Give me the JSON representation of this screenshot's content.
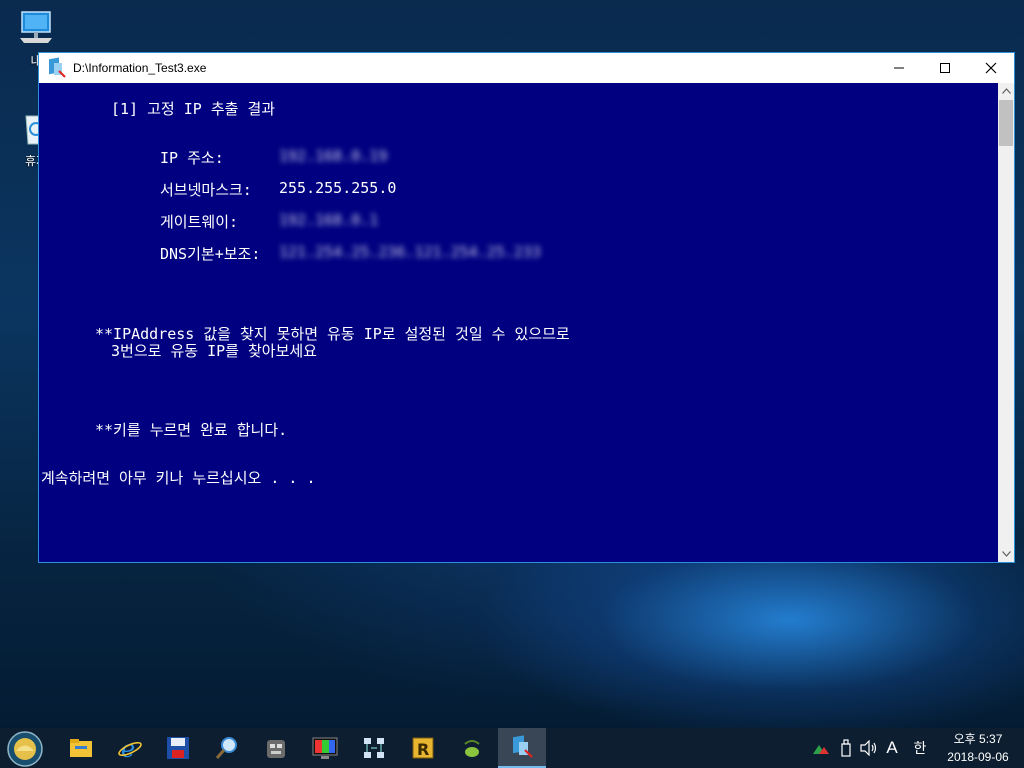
{
  "desktop": {
    "icons": [
      {
        "label": "내",
        "icon": "computer-icon"
      },
      {
        "label": "휴지",
        "icon": "recycle-bin-icon"
      }
    ]
  },
  "window": {
    "title": "D:\\Information_Test3.exe",
    "app_icon": "information-app-icon",
    "buttons": {
      "minimize": "minimize-icon",
      "maximize": "maximize-icon",
      "close": "close-icon"
    }
  },
  "console": {
    "heading": "[1] 고정 IP 추출 결과",
    "fields": [
      {
        "label": "IP 주소:",
        "value": "192.168.0.19",
        "blurred": true
      },
      {
        "label": "서브넷마스크:",
        "value": "255.255.255.0",
        "blurred": false
      },
      {
        "label": "게이트웨이:",
        "value": "192.168.0.1",
        "blurred": true
      },
      {
        "label": "DNS기본+보조:",
        "value": "121.254.25.236.121.254.25.233",
        "blurred": true
      }
    ],
    "note_line1": "**IPAddress 값을 찾지 못하면 유동 IP로 설정된 것일 수 있으므로",
    "note_line2": "3번으로 유동 IP를 찾아보세요",
    "press_key": "**키를 누르면 완료 합니다.",
    "pause_prompt": "계속하려면 아무 키나 누르십시오 . . ."
  },
  "taskbar": {
    "apps": [
      "start-orb-icon",
      "file-explorer-icon",
      "internet-explorer-icon",
      "save-disk-icon",
      "search-magnifier-icon",
      "robot-app-icon",
      "color-monitor-icon",
      "network-icon",
      "r-app-icon",
      "olive-app-icon",
      "information-app-icon"
    ],
    "tray_icons": [
      "network-status-icon",
      "usb-device-icon",
      "volume-icon",
      "input-mode-icon",
      "korean-ime-icon"
    ],
    "tray_text": {
      "input_mode": "A",
      "ime": "한"
    },
    "clock_time": "오후 5:37",
    "clock_date": "2018-09-06"
  }
}
